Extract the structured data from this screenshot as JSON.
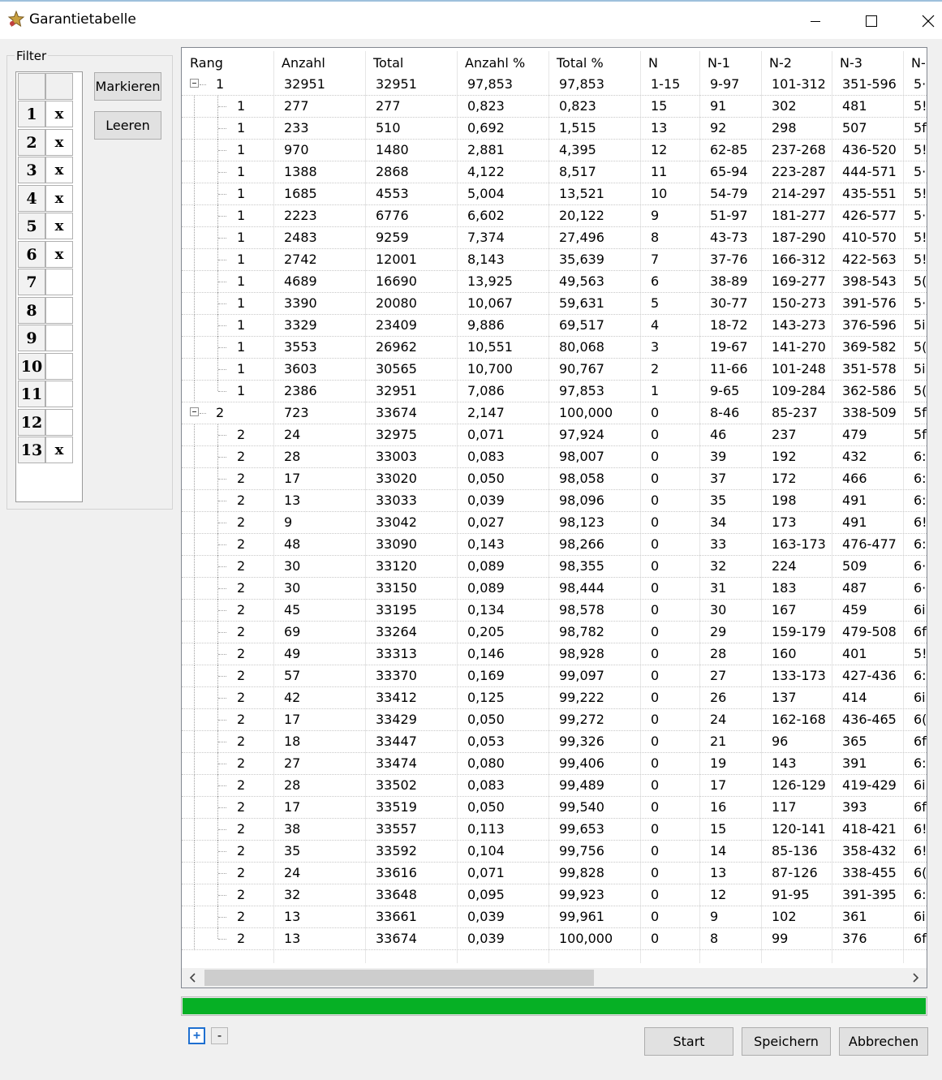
{
  "window": {
    "title": "Garantietabelle"
  },
  "filter": {
    "label": "Filter",
    "rows": [
      {
        "num": "1",
        "mark": "x"
      },
      {
        "num": "2",
        "mark": "x"
      },
      {
        "num": "3",
        "mark": "x"
      },
      {
        "num": "4",
        "mark": "x"
      },
      {
        "num": "5",
        "mark": "x"
      },
      {
        "num": "6",
        "mark": "x"
      },
      {
        "num": "7",
        "mark": ""
      },
      {
        "num": "8",
        "mark": ""
      },
      {
        "num": "9",
        "mark": ""
      },
      {
        "num": "10",
        "mark": ""
      },
      {
        "num": "11",
        "mark": ""
      },
      {
        "num": "12",
        "mark": ""
      },
      {
        "num": "13",
        "mark": "x"
      }
    ],
    "markieren_label": "Markieren",
    "leeren_label": "Leeren"
  },
  "table": {
    "columns": [
      "Rang",
      "Anzahl",
      "Total",
      "Anzahl %",
      "Total %",
      "N",
      "N-1",
      "N-2",
      "N-3",
      "N-"
    ],
    "groups": [
      {
        "row": [
          "1",
          "32951",
          "32951",
          "97,853",
          "97,853",
          "1-15",
          "9-97",
          "101-312",
          "351-596",
          "5·"
        ],
        "children": [
          [
            "1",
            "277",
            "277",
            "0,823",
            "0,823",
            "15",
            "91",
            "302",
            "481",
            "5!"
          ],
          [
            "1",
            "233",
            "510",
            "0,692",
            "1,515",
            "13",
            "92",
            "298",
            "507",
            "5f"
          ],
          [
            "1",
            "970",
            "1480",
            "2,881",
            "4,395",
            "12",
            "62-85",
            "237-268",
            "436-520",
            "5!"
          ],
          [
            "1",
            "1388",
            "2868",
            "4,122",
            "8,517",
            "11",
            "65-94",
            "223-287",
            "444-571",
            "5·"
          ],
          [
            "1",
            "1685",
            "4553",
            "5,004",
            "13,521",
            "10",
            "54-79",
            "214-297",
            "435-551",
            "5!"
          ],
          [
            "1",
            "2223",
            "6776",
            "6,602",
            "20,122",
            "9",
            "51-97",
            "181-277",
            "426-577",
            "5·"
          ],
          [
            "1",
            "2483",
            "9259",
            "7,374",
            "27,496",
            "8",
            "43-73",
            "187-290",
            "410-570",
            "5!"
          ],
          [
            "1",
            "2742",
            "12001",
            "8,143",
            "35,639",
            "7",
            "37-76",
            "166-312",
            "422-563",
            "5!"
          ],
          [
            "1",
            "4689",
            "16690",
            "13,925",
            "49,563",
            "6",
            "38-89",
            "169-277",
            "398-543",
            "5("
          ],
          [
            "1",
            "3390",
            "20080",
            "10,067",
            "59,631",
            "5",
            "30-77",
            "150-273",
            "391-576",
            "5·"
          ],
          [
            "1",
            "3329",
            "23409",
            "9,886",
            "69,517",
            "4",
            "18-72",
            "143-273",
            "376-596",
            "5i"
          ],
          [
            "1",
            "3553",
            "26962",
            "10,551",
            "80,068",
            "3",
            "19-67",
            "141-270",
            "369-582",
            "5("
          ],
          [
            "1",
            "3603",
            "30565",
            "10,700",
            "90,767",
            "2",
            "11-66",
            "101-248",
            "351-578",
            "5i"
          ],
          [
            "1",
            "2386",
            "32951",
            "7,086",
            "97,853",
            "1",
            "9-65",
            "109-284",
            "362-586",
            "5("
          ]
        ]
      },
      {
        "row": [
          "2",
          "723",
          "33674",
          "2,147",
          "100,000",
          "0",
          "8-46",
          "85-237",
          "338-509",
          "5f"
        ],
        "children": [
          [
            "2",
            "24",
            "32975",
            "0,071",
            "97,924",
            "0",
            "46",
            "237",
            "479",
            "5f"
          ],
          [
            "2",
            "28",
            "33003",
            "0,083",
            "98,007",
            "0",
            "39",
            "192",
            "432",
            "6:"
          ],
          [
            "2",
            "17",
            "33020",
            "0,050",
            "98,058",
            "0",
            "37",
            "172",
            "466",
            "6:"
          ],
          [
            "2",
            "13",
            "33033",
            "0,039",
            "98,096",
            "0",
            "35",
            "198",
            "491",
            "6:"
          ],
          [
            "2",
            "9",
            "33042",
            "0,027",
            "98,123",
            "0",
            "34",
            "173",
            "491",
            "6!"
          ],
          [
            "2",
            "48",
            "33090",
            "0,143",
            "98,266",
            "0",
            "33",
            "163-173",
            "476-477",
            "6:"
          ],
          [
            "2",
            "30",
            "33120",
            "0,089",
            "98,355",
            "0",
            "32",
            "224",
            "509",
            "6·"
          ],
          [
            "2",
            "30",
            "33150",
            "0,089",
            "98,444",
            "0",
            "31",
            "183",
            "487",
            "6·"
          ],
          [
            "2",
            "45",
            "33195",
            "0,134",
            "98,578",
            "0",
            "30",
            "167",
            "459",
            "6i"
          ],
          [
            "2",
            "69",
            "33264",
            "0,205",
            "98,782",
            "0",
            "29",
            "159-179",
            "479-508",
            "6f"
          ],
          [
            "2",
            "49",
            "33313",
            "0,146",
            "98,928",
            "0",
            "28",
            "160",
            "401",
            "5!"
          ],
          [
            "2",
            "57",
            "33370",
            "0,169",
            "99,097",
            "0",
            "27",
            "133-173",
            "427-436",
            "6:"
          ],
          [
            "2",
            "42",
            "33412",
            "0,125",
            "99,222",
            "0",
            "26",
            "137",
            "414",
            "6i"
          ],
          [
            "2",
            "17",
            "33429",
            "0,050",
            "99,272",
            "0",
            "24",
            "162-168",
            "436-465",
            "6("
          ],
          [
            "2",
            "18",
            "33447",
            "0,053",
            "99,326",
            "0",
            "21",
            "96",
            "365",
            "6f"
          ],
          [
            "2",
            "27",
            "33474",
            "0,080",
            "99,406",
            "0",
            "19",
            "143",
            "391",
            "6:"
          ],
          [
            "2",
            "28",
            "33502",
            "0,083",
            "99,489",
            "0",
            "17",
            "126-129",
            "419-429",
            "6i"
          ],
          [
            "2",
            "17",
            "33519",
            "0,050",
            "99,540",
            "0",
            "16",
            "117",
            "393",
            "6f"
          ],
          [
            "2",
            "38",
            "33557",
            "0,113",
            "99,653",
            "0",
            "15",
            "120-141",
            "418-421",
            "6!"
          ],
          [
            "2",
            "35",
            "33592",
            "0,104",
            "99,756",
            "0",
            "14",
            "85-136",
            "358-432",
            "6!"
          ],
          [
            "2",
            "24",
            "33616",
            "0,071",
            "99,828",
            "0",
            "13",
            "87-126",
            "338-455",
            "6("
          ],
          [
            "2",
            "32",
            "33648",
            "0,095",
            "99,923",
            "0",
            "12",
            "91-95",
            "391-395",
            "6:"
          ],
          [
            "2",
            "13",
            "33661",
            "0,039",
            "99,961",
            "0",
            "9",
            "102",
            "361",
            "6i"
          ],
          [
            "2",
            "13",
            "33674",
            "0,039",
            "100,000",
            "0",
            "8",
            "99",
            "376",
            "6f"
          ]
        ]
      }
    ]
  },
  "progress": {
    "fraction": 1.0,
    "color": "#06b025"
  },
  "buttons": {
    "expand_label": "+",
    "collapse_label": "-",
    "start_label": "Start",
    "save_label": "Speichern",
    "cancel_label": "Abbrechen"
  },
  "icons": {
    "app": "app-icon",
    "minimize": "minimize-icon",
    "maximize": "maximize-icon",
    "close": "close-icon",
    "scroll_left": "scroll-left-icon",
    "scroll_right": "scroll-right-icon"
  }
}
